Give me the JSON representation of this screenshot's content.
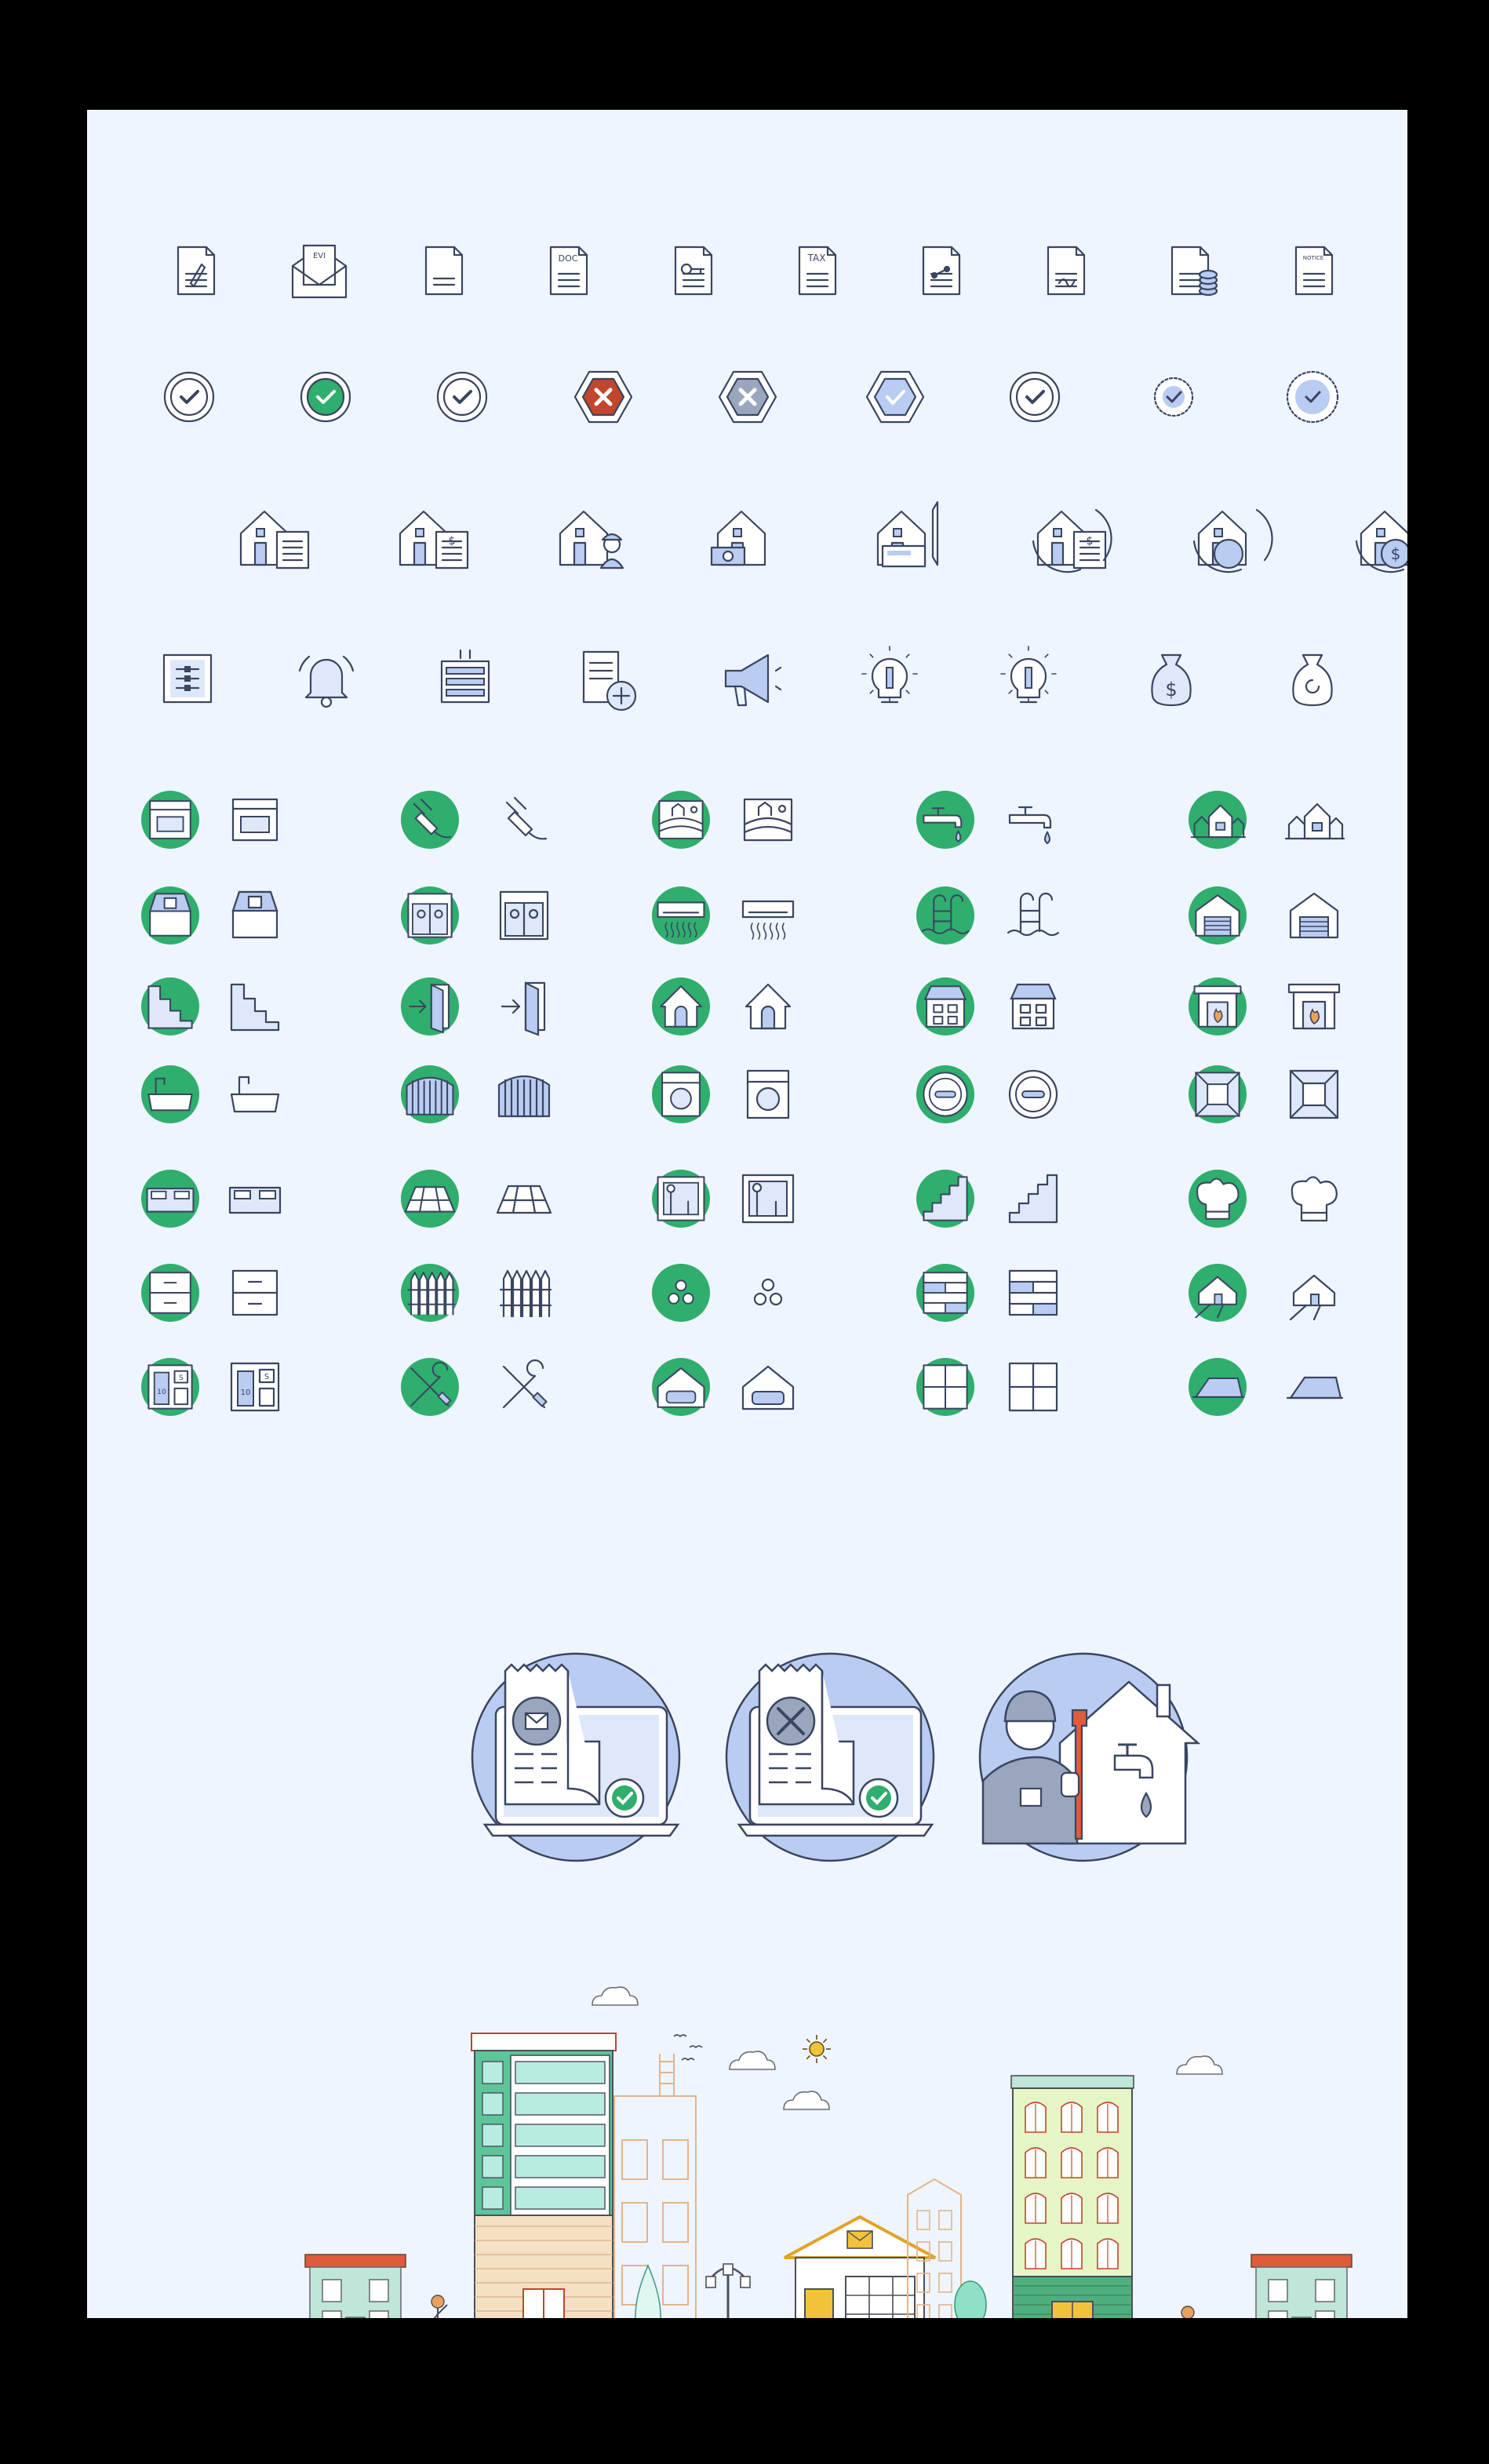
{
  "palette": {
    "background": "#000000",
    "sheet": "#eef5fe",
    "outline": "#3a4560",
    "green": "#2fae6e",
    "blue_fill": "#b9ccf2",
    "light_blue": "#dfe8fb",
    "red": "#c2452d",
    "grey_fill": "#9aa6bd",
    "orange": "#e8a25c",
    "teal": "#5ec49a",
    "yellow": "#f2c23a",
    "pale_green": "#e6f5c5",
    "salmon": "#e05a3c"
  },
  "document_labels": {
    "eviction": "EVICTION",
    "doc": "DOC",
    "tax": "TAX",
    "notice": "NOTICE",
    "money": "$",
    "room_number": "10",
    "room_sign": "S"
  },
  "rows": {
    "documents": [
      "pencil-document-icon",
      "eviction-letter-icon",
      "blank-document-icon",
      "doc-file-icon",
      "key-document-icon",
      "tax-document-icon",
      "network-document-icon",
      "signed-contract-icon",
      "document-with-coins-icon",
      "notice-document-icon"
    ],
    "status": [
      "check-circle-icon",
      "check-circle-green-icon",
      "check-circle-outline-icon",
      "error-hexagon-red-icon",
      "error-hexagon-grey-icon",
      "check-hexagon-blue-icon",
      "check-circle-badge-icon",
      "check-dotted-small-icon",
      "check-dotted-circle-icon"
    ],
    "real_estate": [
      "house-contract-icon",
      "house-invoice-icon",
      "house-builder-icon",
      "house-money-icon",
      "house-check-pen-icon",
      "house-refund-document-icon",
      "house-cash-exchange-icon",
      "house-dollar-exchange-icon"
    ],
    "misc": [
      "control-panel-icon",
      "alarm-bell-icon",
      "server-rack-icon",
      "add-document-icon",
      "megaphone-icon",
      "idea-bulb-icon",
      "info-bulb-icon",
      "money-bag-icon",
      "refresh-bag-icon"
    ]
  },
  "amenity_columns": [
    [
      "oven",
      "house-window",
      "stairs-floor",
      "bathtub",
      "bed",
      "drawer",
      "hotel-room-board"
    ],
    [
      "power-plug",
      "elevator",
      "enter-door",
      "gate",
      "floor-tiles",
      "fence",
      "tools"
    ],
    [
      "landscape-field",
      "air-conditioner",
      "home-door",
      "washing-machine",
      "window-view",
      "bubbles",
      "garage-car"
    ],
    [
      "water-tap",
      "pool-ladder",
      "small-house",
      "smoke-detector",
      "staircase",
      "brick-wall",
      "window-panes"
    ],
    [
      "neighborhood",
      "garage",
      "fireplace",
      "room-perspective",
      "chef-hat",
      "driveway-house",
      "roof"
    ]
  ],
  "illustrations": [
    "online-payment-mail-illustration",
    "online-payment-repair-illustration",
    "plumber-service-illustration"
  ],
  "street_scene": [
    "small-house-left",
    "tall-teal-building",
    "beige-building-outline",
    "street-lamp",
    "post-office",
    "pale-green-apartment",
    "small-house-right",
    "sun",
    "clouds",
    "birds",
    "people"
  ]
}
